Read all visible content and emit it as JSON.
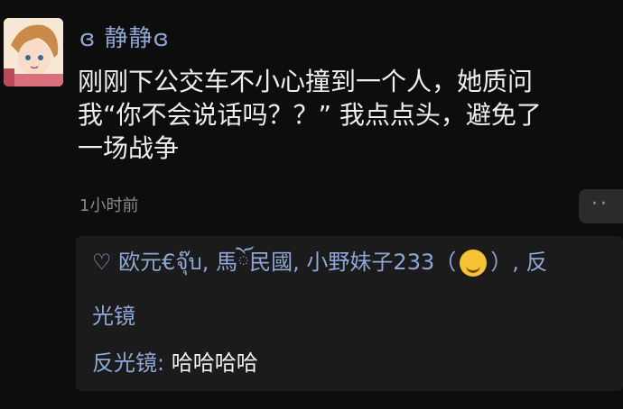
{
  "post": {
    "username": "ɞ 静静ɞ",
    "lines": [
      "刚刚下公交车不小心撞到一个人，她质问",
      "我“你不会说话吗？？” 我点点头，避免了",
      "一场战争"
    ],
    "time": "1小时前",
    "more_label": "··"
  },
  "likes": {
    "heart_icon": "heart-outline-icon",
    "line1_before_emoji": "♡ 欧元€จุ๊บ, 馬ོ民國, 小野妹子233（",
    "line1_after_emoji": "）, 反",
    "line2": "光镜",
    "emoji_icon": "grinning-face-emoji"
  },
  "comment": {
    "author": "反光镜",
    "separator": ": ",
    "text": "哈哈哈哈"
  },
  "colors": {
    "background": "#0d0d0d",
    "name_blue": "#8fa7d6",
    "panel": "#1b1b1b"
  }
}
